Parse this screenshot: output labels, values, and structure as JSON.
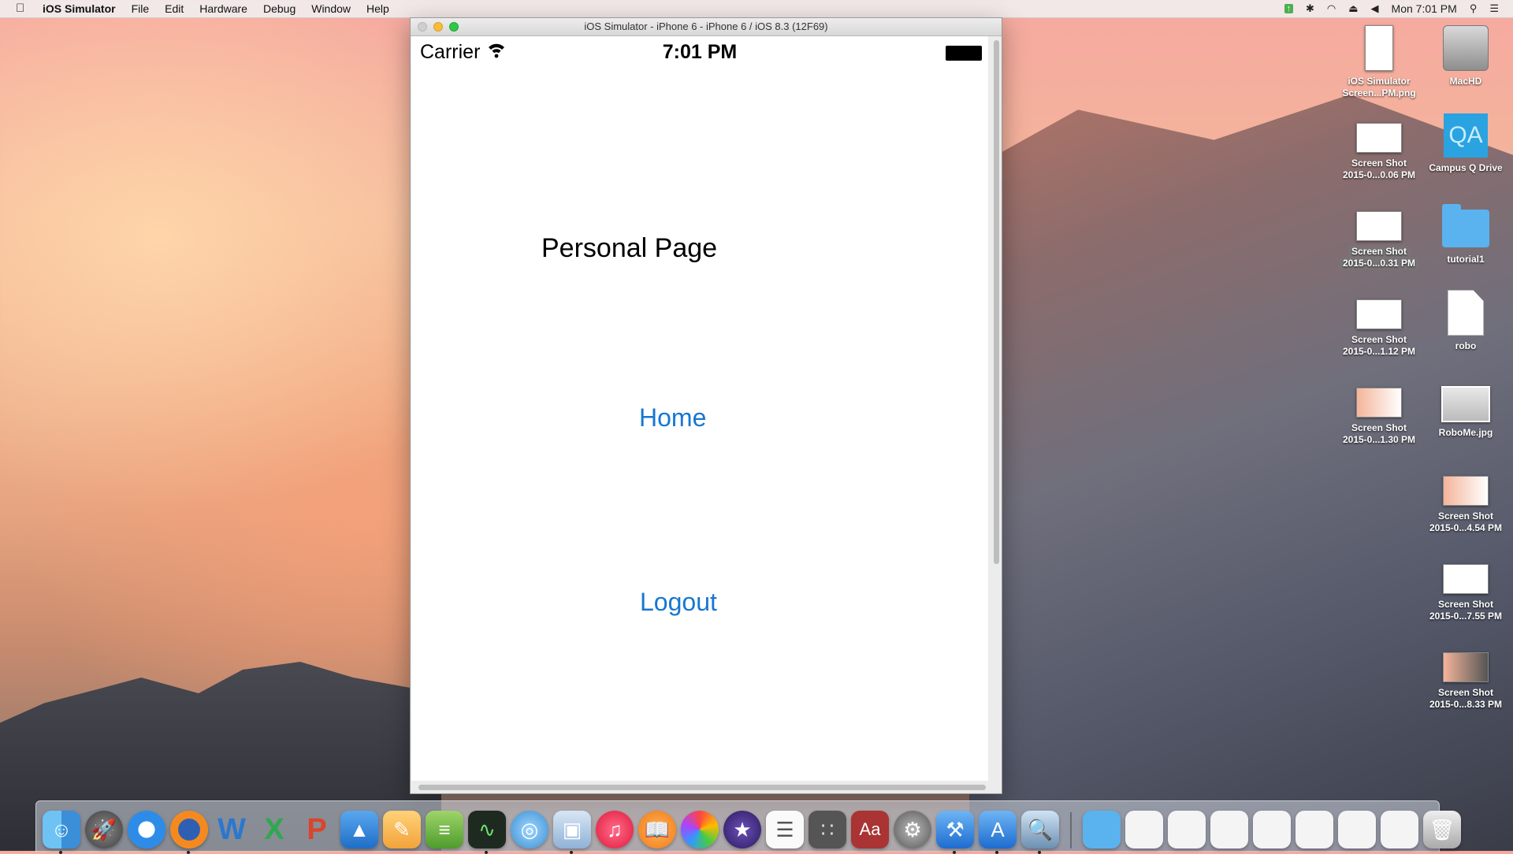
{
  "menubar": {
    "app_name": "iOS Simulator",
    "menus": [
      "File",
      "Edit",
      "Hardware",
      "Debug",
      "Window",
      "Help"
    ],
    "clock": "Mon 7:01 PM"
  },
  "window": {
    "title": "iOS Simulator - iPhone 6 - iPhone 6 / iOS 8.3 (12F69)"
  },
  "device": {
    "carrier": "Carrier",
    "time": "7:01 PM",
    "page_title": "Personal Page",
    "home_label": "Home",
    "logout_label": "Logout",
    "link_color": "#1677d2"
  },
  "desktop_icons": [
    {
      "line1": "iOS Simulator",
      "line2": "Screen...PM.png",
      "kind": "screenshot-doc"
    },
    {
      "line1": "MacHD",
      "line2": "",
      "kind": "drive"
    },
    {
      "line1": "Screen Shot",
      "line2": "2015-0...0.06 PM",
      "kind": "screenshot"
    },
    {
      "line1": "Campus Q Drive",
      "line2": "",
      "kind": "network-drive",
      "glyph": "QA"
    },
    {
      "line1": "Screen Shot",
      "line2": "2015-0...0.31 PM",
      "kind": "screenshot",
      "selected": true
    },
    {
      "line1": "tutorial1",
      "line2": "",
      "kind": "folder"
    },
    {
      "line1": "Screen Shot",
      "line2": "2015-0...1.12 PM",
      "kind": "screenshot"
    },
    {
      "line1": "robo",
      "line2": "",
      "kind": "document"
    },
    {
      "line1": "Screen Shot",
      "line2": "2015-0...1.30 PM",
      "kind": "screenshot"
    },
    {
      "line1": "RoboMe.jpg",
      "line2": "",
      "kind": "image"
    },
    {
      "line1": "Screen Shot",
      "line2": "2015-0...4.54 PM",
      "kind": "screenshot"
    },
    {
      "line1": "Screen Shot",
      "line2": "2015-0...7.55 PM",
      "kind": "screenshot"
    },
    {
      "line1": "Screen Shot",
      "line2": "2015-0...8.33 PM",
      "kind": "screenshot"
    }
  ],
  "dock": {
    "apps": [
      "finder-icon",
      "launchpad-icon",
      "safari-icon",
      "firefox-icon",
      "word-icon",
      "excel-icon",
      "powerpoint-icon",
      "keynote-icon",
      "pages-icon",
      "numbers-icon",
      "activity-monitor-icon",
      "network-icon",
      "box-icon",
      "itunes-icon",
      "ibooks-icon",
      "photos-icon",
      "imovie-icon",
      "textedit-icon",
      "calculator-icon",
      "dictionary-icon",
      "system-preferences-icon",
      "xcode-icon",
      "app-store-icon",
      "preview-icon"
    ],
    "stacks": [
      "applications-folder-icon",
      "doc-stack-1-icon",
      "doc-stack-2-icon",
      "doc-stack-3-icon",
      "doc-stack-4-icon",
      "doc-stack-5-icon",
      "doc-stack-6-icon",
      "doc-stack-7-icon",
      "trash-icon"
    ]
  }
}
